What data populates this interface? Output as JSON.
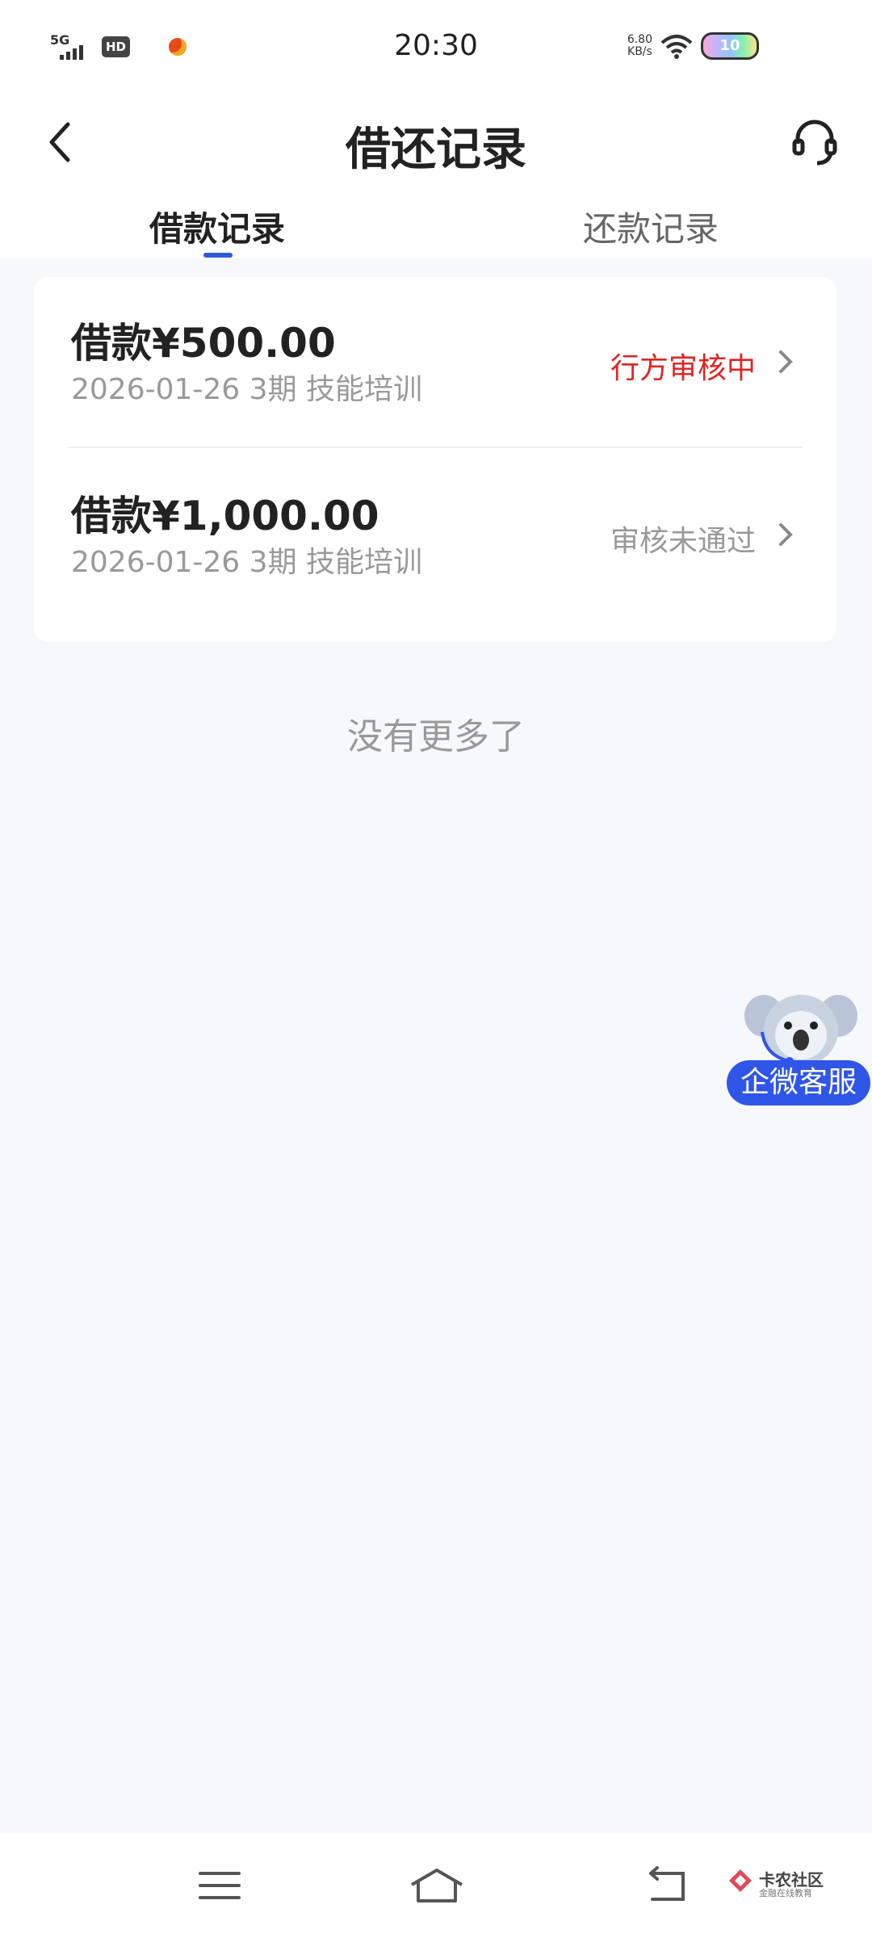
{
  "status_bar": {
    "network": "5G",
    "hd": "HD",
    "time": "20:30",
    "speed_value": "6.80",
    "speed_unit": "KB/s",
    "battery": "10"
  },
  "header": {
    "title": "借还记录",
    "back_icon": "chevron-left-icon",
    "service_icon": "headset-icon"
  },
  "tabs": [
    {
      "label": "借款记录",
      "active": true
    },
    {
      "label": "还款记录",
      "active": false
    }
  ],
  "records": [
    {
      "amount": "借款¥500.00",
      "meta": "2026-01-26 3期  技能培训",
      "status": "行方审核中",
      "status_color": "#e02424"
    },
    {
      "amount": "借款¥1,000.00",
      "meta": "2026-01-26 3期  技能培训",
      "status": "审核未通过",
      "status_color": "#999999"
    }
  ],
  "no_more": "没有更多了",
  "floating_service": {
    "label": "企微客服",
    "icon": "koala-mascot-icon"
  },
  "bottom_nav": {
    "menu_icon": "menu-icon",
    "home_icon": "home-icon",
    "back_icon": "back-icon"
  },
  "watermark": {
    "title": "卡农社区",
    "subtitle": "金融在线教育"
  },
  "colors": {
    "accent": "#2d5bd8",
    "background": "#f7f8fc",
    "pending": "#e02424",
    "rejected": "#999999"
  }
}
